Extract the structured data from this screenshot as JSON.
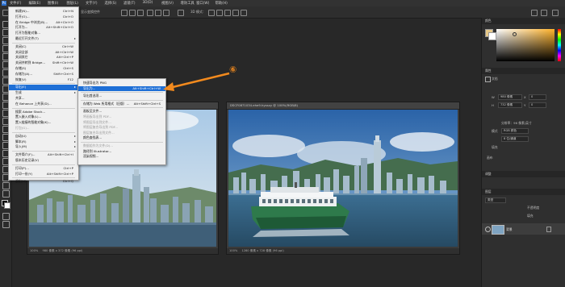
{
  "menubar": {
    "items": [
      "文件(F)",
      "编辑(E)",
      "图像(I)",
      "图层(L)",
      "文字(Y)",
      "选择(S)",
      "滤镜(T)",
      "3D(D)",
      "视图(V)",
      "增效工具",
      "窗口(W)",
      "帮助(H)"
    ]
  },
  "options": {
    "show_transform": "显示变换控件",
    "mode_3d": "3D 模式："
  },
  "file_menu": {
    "items": [
      {
        "label": "新建(N)...",
        "shortcut": "Ctrl+N"
      },
      {
        "label": "打开(O)...",
        "shortcut": "Ctrl+O"
      },
      {
        "label": "在 Bridge 中浏览(B)...",
        "shortcut": "Alt+Ctrl+O"
      },
      {
        "label": "打开为...",
        "shortcut": "Alt+Shift+Ctrl+O"
      },
      {
        "label": "打开为智能对象...",
        "shortcut": ""
      },
      {
        "label": "最近打开文件(T)",
        "shortcut": "",
        "submenu": true
      },
      {
        "sep": true
      },
      {
        "label": "关闭(C)",
        "shortcut": "Ctrl+W"
      },
      {
        "label": "关闭全部",
        "shortcut": "Alt+Ctrl+W"
      },
      {
        "label": "关闭其它",
        "shortcut": "Alt+Ctrl+P"
      },
      {
        "label": "关闭并转到 Bridge...",
        "shortcut": "Shift+Ctrl+W"
      },
      {
        "label": "存储(S)",
        "shortcut": "Ctrl+S"
      },
      {
        "label": "存储为(A)...",
        "shortcut": "Shift+Ctrl+S"
      },
      {
        "label": "恢复(V)",
        "shortcut": "F12"
      },
      {
        "sep": true
      },
      {
        "label": "导出(E)",
        "shortcut": "",
        "submenu": true,
        "highlight": true
      },
      {
        "label": "生成",
        "shortcut": "",
        "submenu": true
      },
      {
        "label": "共享...",
        "shortcut": ""
      },
      {
        "label": "在 Behance 上共享(D)...",
        "shortcut": ""
      },
      {
        "sep": true
      },
      {
        "label": "搜索 Adobe Stock...",
        "shortcut": ""
      },
      {
        "label": "置入嵌入对象(L)...",
        "shortcut": ""
      },
      {
        "label": "置入链接的智能对象(K)...",
        "shortcut": ""
      },
      {
        "label": "打包(G)...",
        "shortcut": "",
        "disabled": true
      },
      {
        "sep": true
      },
      {
        "label": "自动(U)",
        "shortcut": "",
        "submenu": true
      },
      {
        "label": "脚本(R)",
        "shortcut": "",
        "submenu": true
      },
      {
        "label": "导入(M)",
        "shortcut": "",
        "submenu": true
      },
      {
        "sep": true
      },
      {
        "label": "文件简介(F)...",
        "shortcut": "Alt+Shift+Ctrl+I"
      },
      {
        "label": "版本历史记录(V)",
        "shortcut": ""
      },
      {
        "sep": true
      },
      {
        "label": "打印(P)...",
        "shortcut": "Ctrl+P"
      },
      {
        "label": "打印一份(Y)",
        "shortcut": "Alt+Shift+Ctrl+P"
      },
      {
        "sep": true
      },
      {
        "label": "退出(X)",
        "shortcut": "Ctrl+Q"
      }
    ]
  },
  "export_submenu": {
    "items": [
      {
        "label": "快速导出为 PNG",
        "shortcut": ""
      },
      {
        "label": "导出为...",
        "shortcut": "Alt+Shift+Ctrl+W",
        "highlight": true
      },
      {
        "sep": true
      },
      {
        "label": "导出首选项...",
        "shortcut": ""
      },
      {
        "sep": true
      },
      {
        "label": "存储为 Web 所用格式（旧版）...",
        "shortcut": "Alt+Shift+Ctrl+S"
      },
      {
        "sep": true
      },
      {
        "label": "画板至文件...",
        "shortcut": ""
      },
      {
        "label": "将画板导出到 PDF...",
        "shortcut": "",
        "disabled": true
      },
      {
        "label": "将图层导出到文件...",
        "shortcut": "",
        "disabled": true
      },
      {
        "label": "将图层复合导出到 PDF...",
        "shortcut": "",
        "disabled": true
      },
      {
        "label": "图层复合导出到文件...",
        "shortcut": "",
        "disabled": true
      },
      {
        "label": "颜色查找表...",
        "shortcut": ""
      },
      {
        "sep": true
      },
      {
        "label": "数据组作为文件(D)...",
        "shortcut": "",
        "disabled": true
      },
      {
        "label": "路径到 Illustrator...",
        "shortcut": ""
      },
      {
        "label": "渲染视频...",
        "shortcut": ""
      }
    ]
  },
  "annotation": {
    "number": "⑥",
    "color": "#f28a1e"
  },
  "doc_left": {
    "zoom": "100%",
    "status": "980 像素 x 372 像素 (96 ppi)"
  },
  "doc_right": {
    "title": "DSCF0871034.ehe9.hyssxy @ 100%(RGB/8)",
    "zoom": "100%",
    "status": "1280 像素 x 728 像素 (96 ppi)"
  },
  "right_panel": {
    "color_tab": "颜色",
    "properties_tab": "属性",
    "doc_label": "文档",
    "w_label": "W",
    "w_value": "980 像素",
    "h_label": "H",
    "h_value": "732 像素",
    "x_label": "X",
    "x_value": "0",
    "y_label": "Y",
    "y_value": "0",
    "resolution": "分辨率：96 像素/英寸",
    "mode_label": "模式",
    "mode_value": "RGB 颜色",
    "bits": "8 位/通道",
    "fill_label": "填充",
    "canvas_section": "画布",
    "adjust_tab": "调整",
    "layers_tab": "图层",
    "layer_name": "背景",
    "layer_kind": "类型",
    "opacity_label": "不透明度",
    "fill_label2": "填充"
  }
}
